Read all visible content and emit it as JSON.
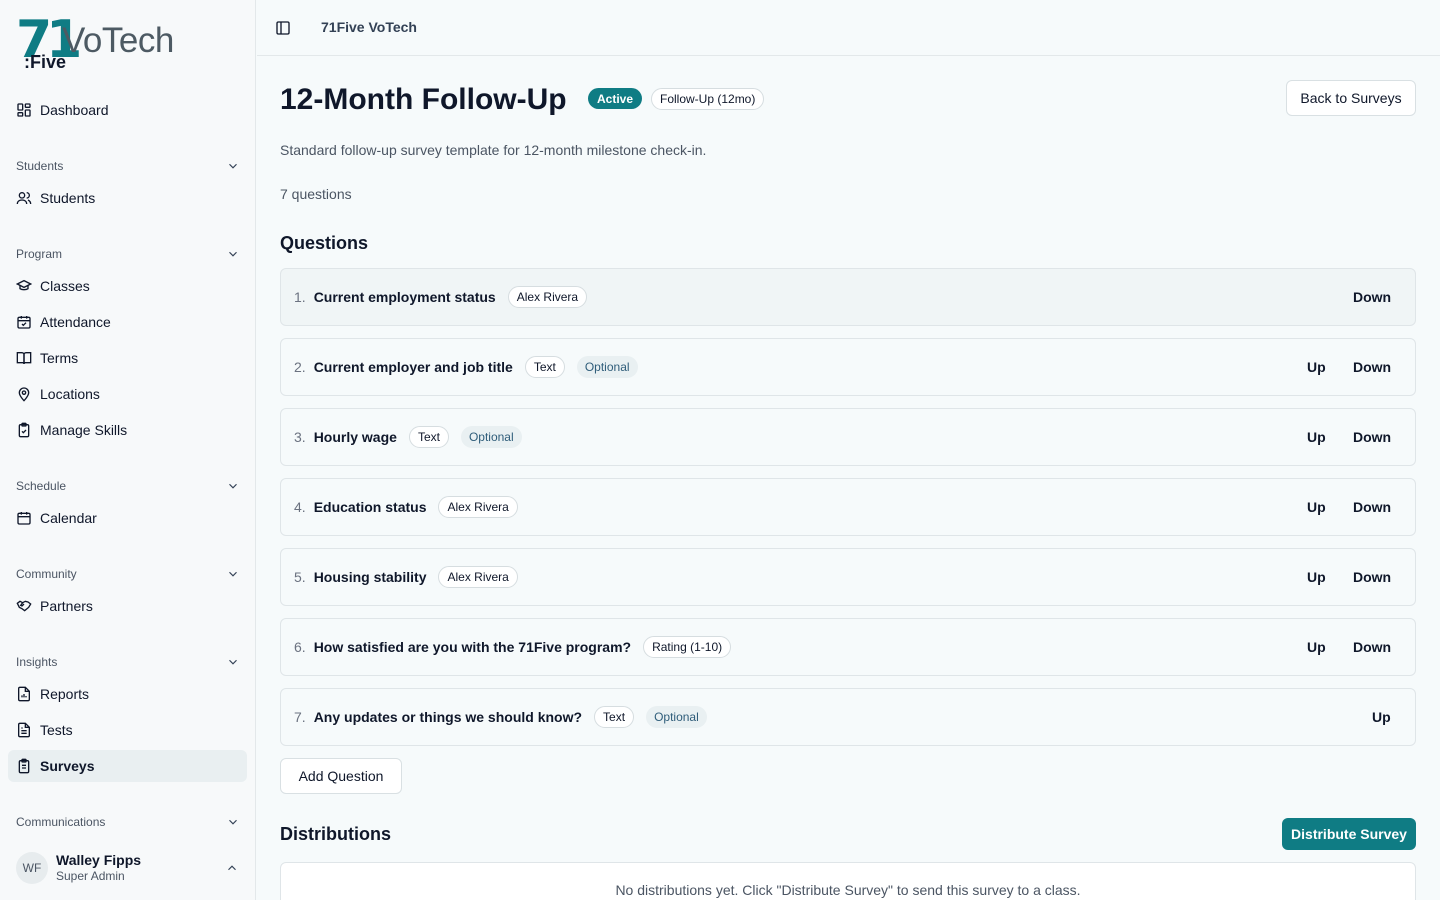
{
  "logo": {
    "mark": "71",
    "name": "VoTech",
    "sub": ":Five"
  },
  "sidebar": {
    "dashboard": "Dashboard",
    "sections": [
      {
        "label": "Students",
        "items": [
          "Students"
        ]
      },
      {
        "label": "Program",
        "items": [
          "Classes",
          "Attendance",
          "Terms",
          "Locations",
          "Manage Skills"
        ]
      },
      {
        "label": "Schedule",
        "items": [
          "Calendar"
        ]
      },
      {
        "label": "Community",
        "items": [
          "Partners"
        ]
      },
      {
        "label": "Insights",
        "items": [
          "Reports",
          "Tests",
          "Surveys"
        ]
      },
      {
        "label": "Communications",
        "items": []
      }
    ],
    "active_item": "Surveys"
  },
  "user": {
    "initials": "WF",
    "name": "Walley Fipps",
    "role": "Super Admin"
  },
  "header": {
    "breadcrumb": "71Five VoTech"
  },
  "page": {
    "title": "12-Month Follow-Up",
    "status_badge": "Active",
    "type_badge": "Follow-Up (12mo)",
    "back_button": "Back to Surveys",
    "description": "Standard follow-up survey template for 12-month milestone check-in.",
    "question_count": "7 questions"
  },
  "questions_section": {
    "heading": "Questions",
    "up_label": "Up",
    "down_label": "Down",
    "items": [
      {
        "num": "1.",
        "text": "Current employment status",
        "tag": "Alex Rivera",
        "optional": ""
      },
      {
        "num": "2.",
        "text": "Current employer and job title",
        "tag": "Text",
        "optional": "Optional"
      },
      {
        "num": "3.",
        "text": "Hourly wage",
        "tag": "Text",
        "optional": "Optional"
      },
      {
        "num": "4.",
        "text": "Education status",
        "tag": "Alex Rivera",
        "optional": ""
      },
      {
        "num": "5.",
        "text": "Housing stability",
        "tag": "Alex Rivera",
        "optional": ""
      },
      {
        "num": "6.",
        "text": "How satisfied are you with the 71Five program?",
        "tag": "Rating (1-10)",
        "optional": ""
      },
      {
        "num": "7.",
        "text": "Any updates or things we should know?",
        "tag": "Text",
        "optional": "Optional"
      }
    ],
    "add_button": "Add Question"
  },
  "distributions": {
    "heading": "Distributions",
    "distribute_button": "Distribute Survey",
    "empty_message": "No distributions yet. Click \"Distribute Survey\" to send this survey to a class."
  },
  "colors": {
    "accent": "#0f7c84",
    "logo_gray": "#4d5a63"
  }
}
